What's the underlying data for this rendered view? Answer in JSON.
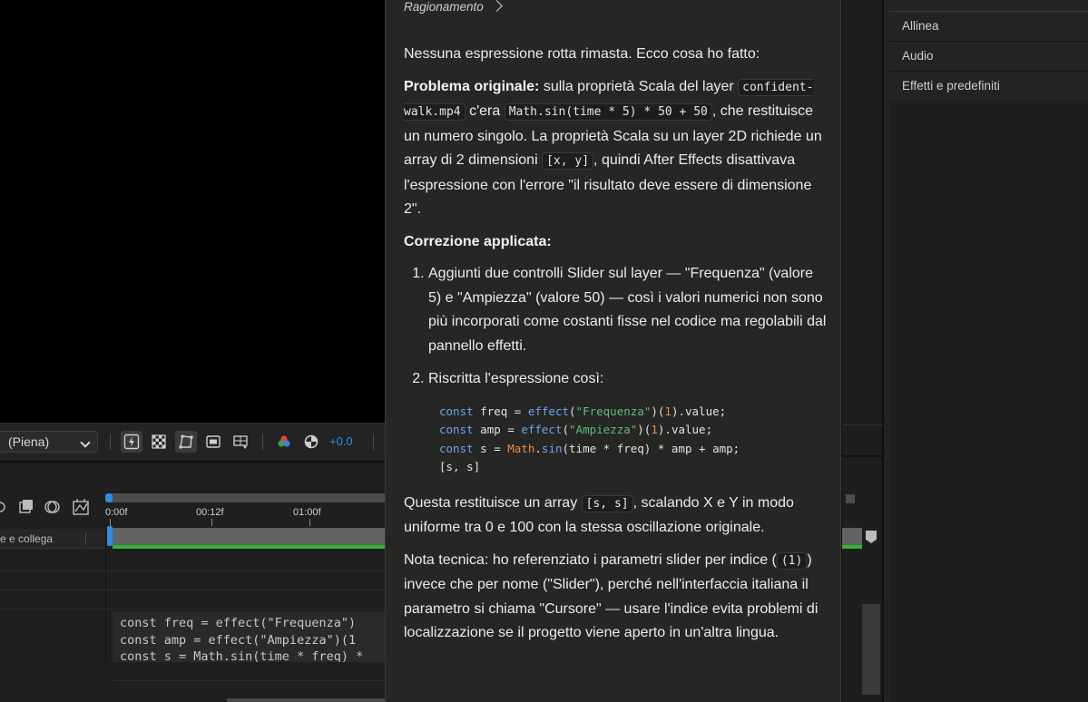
{
  "viewer": {
    "resolution": "(Piena)",
    "exposure": "+0.0"
  },
  "timeline": {
    "layer_header": "e e collega",
    "ruler": [
      "0:00f",
      "00:12f",
      "01:00f"
    ],
    "expression_preview": [
      "const freq = effect(\"Frequenza\")",
      "const amp = effect(\"Ampiezza\")(1",
      "const s = Math.sin(time * freq) *"
    ]
  },
  "right_panel": {
    "items": [
      "Allinea",
      "Audio",
      "Effetti e predefiniti"
    ]
  },
  "chat": {
    "reasoning_label": "Ragionamento",
    "intro": "Nessuna espressione rotta rimasta. Ecco cosa ho fatto:",
    "problem": {
      "label": "Problema originale:",
      "t1": " sulla proprietà Scala del layer ",
      "layer_name": "confident-walk.mp4",
      "t2": " c'era ",
      "orig_expr": "Math.sin(time * 5) * 50 + 50",
      "t3": ", che restituisce un numero singolo. La proprietà Scala su un layer 2D richiede un array di 2 dimensioni ",
      "array_code": "[x, y]",
      "t4": ", quindi After Effects disattivava l'espressione con l'errore \"il risultato deve essere di dimensione 2\"."
    },
    "fix_heading": "Correzione applicata:",
    "steps": [
      "Aggiunti due controlli Slider sul layer — \"Frequenza\" (valore 5) e \"Ampiezza\" (valore 50) — così i valori numerici non sono più incorporati come costanti fisse nel codice ma regolabili dal pannello effetti.",
      "Riscritta l'espressione così:"
    ],
    "code_block": {
      "line1": {
        "kw": "const",
        "var": "freq",
        "fn": "effect",
        "str": "\"Frequenza\"",
        "num": "1",
        "prop": "value"
      },
      "line2": {
        "kw": "const",
        "var": "amp",
        "fn": "effect",
        "str": "\"Ampiezza\"",
        "num": "1",
        "prop": "value"
      },
      "line3": {
        "kw": "const",
        "var": "s",
        "obj": "Math",
        "fn": "sin",
        "expr": "(time * freq) * amp + amp;"
      },
      "line4": "[s, s]"
    },
    "result": {
      "t1": "Questa restituisce un array ",
      "code": "[s, s]",
      "t2": ", scalando X e Y in modo uniforme tra 0 e 100 con la stessa oscillazione originale."
    },
    "note": {
      "t1": "Nota tecnica: ho referenziato i parametri slider per indice (",
      "code": "(1)",
      "t2": ") invece che per nome (\"Slider\"), perché nell'interfaccia italiana il parametro si chiama \"Cursore\" — usare l'indice evita problemi di localizzazione se il progetto viene aperto in un'altra lingua."
    }
  }
}
